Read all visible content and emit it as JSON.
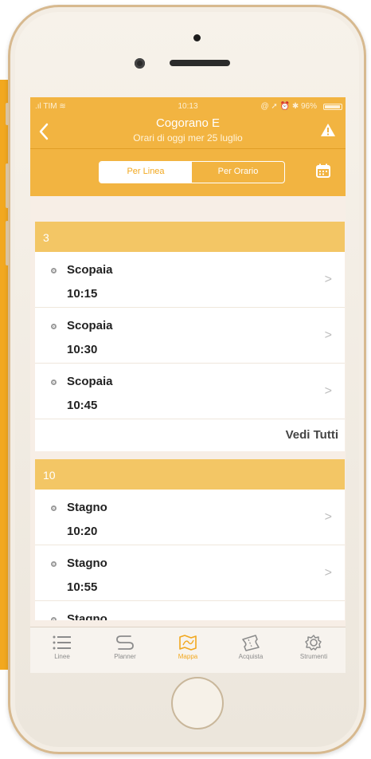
{
  "status": {
    "carrier": "TIM",
    "time": "10:13",
    "battery": "96%",
    "battery_level": 0.96
  },
  "nav": {
    "title": "Cogorano E",
    "subtitle": "Orari di oggi mer 25 luglio"
  },
  "segment": {
    "per_linea": "Per Linea",
    "per_orario": "Per Orario"
  },
  "sections": [
    {
      "line": "3",
      "rows": [
        {
          "dest": "Scopaia",
          "time": "10:15"
        },
        {
          "dest": "Scopaia",
          "time": "10:30"
        },
        {
          "dest": "Scopaia",
          "time": "10:45"
        }
      ],
      "vedi_tutti": "Vedi Tutti"
    },
    {
      "line": "10",
      "rows": [
        {
          "dest": "Stagno",
          "time": "10:20"
        },
        {
          "dest": "Stagno",
          "time": "10:55"
        },
        {
          "dest": "Stagno",
          "time": ""
        }
      ]
    }
  ],
  "tabs": [
    {
      "label": "Linee",
      "icon": "list-icon"
    },
    {
      "label": "Planner",
      "icon": "route-icon"
    },
    {
      "label": "Mappa",
      "icon": "map-icon"
    },
    {
      "label": "Acquista",
      "icon": "ticket-icon"
    },
    {
      "label": "Strumenti",
      "icon": "gear-icon"
    }
  ],
  "colors": {
    "accent": "#F2A81F",
    "section_header": "#F3C665",
    "background": "#F7EEE6"
  }
}
